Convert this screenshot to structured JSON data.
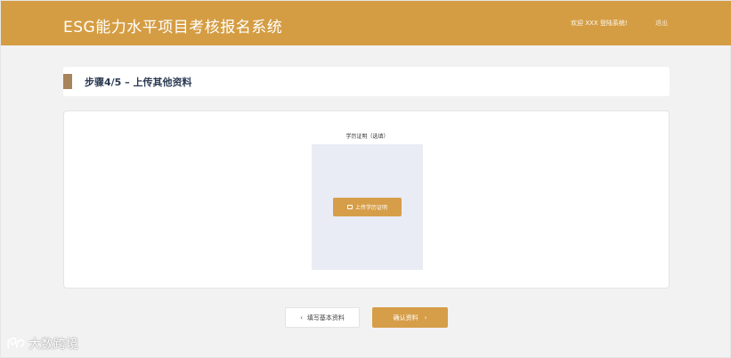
{
  "header": {
    "title": "ESG能力水平项目考核报名系统",
    "welcome": "欢迎 XXX 登陆系统!",
    "logout": "退出"
  },
  "step": {
    "text": "步骤4/5 – 上传其他资料"
  },
  "upload": {
    "label": "学历证明（选填）",
    "button_label": "上传学历证明",
    "icon": "upload-icon"
  },
  "nav": {
    "prev_label": "填写基本资料",
    "next_label": "确认资料"
  },
  "watermark": {
    "text": "大数跨境"
  },
  "colors": {
    "brand": "#d59d43",
    "button": "#d69e49",
    "step_marker": "#a7845a",
    "upload_zone": "#e9ebf5"
  }
}
